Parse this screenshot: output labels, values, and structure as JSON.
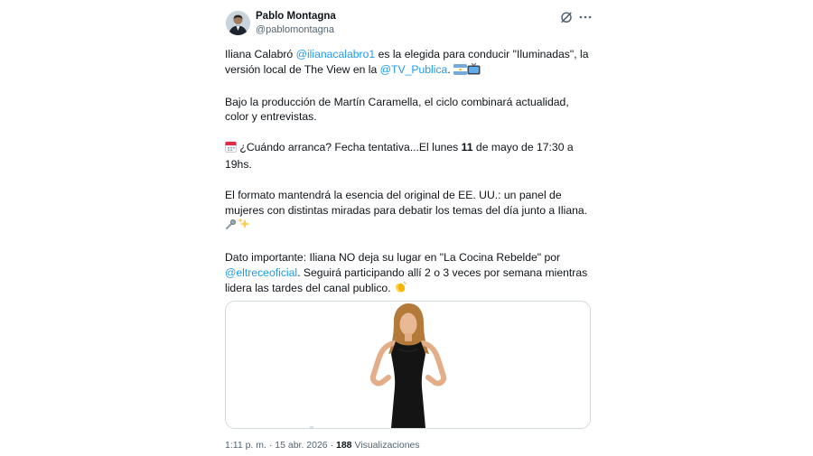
{
  "author": {
    "name": "Pablo Montagna",
    "handle": "@pablomontagna"
  },
  "tweet": {
    "p1": {
      "t1": "Iliana Calabró ",
      "m1": "@ilianacalabro1",
      "t2": " es la elegida para conducir \"Iluminadas\", la versión local de The View en la ",
      "m2": "@TV_Publica",
      "t3": ". "
    },
    "p2": "Bajo la producción de Martín Caramella, el ciclo combinará actualidad, color y entrevistas.",
    "p3": {
      "t1": " ¿Cuándo arranca? Fecha tentativa...El lunes ",
      "bold": "11",
      "t2": " de mayo de 17:30 a 19hs."
    },
    "p4": "El formato mantendrá la esencia del original de EE. UU.: un panel de mujeres con distintas miradas para debatir los temas del día junto a Iliana. ",
    "p5": {
      "t1": "Dato importante: Iliana NO deja su lugar en \"La Cocina Rebelde\" por ",
      "m1": "@eltreceoficial",
      "t2": ". Seguirá participando allí 2 o 3 veces por semana mientras lidera las tardes del canal publico. "
    }
  },
  "emoji_icons": [
    "argentina-flag-icon",
    "television-icon",
    "calendar-icon",
    "microphone-icon",
    "sparkles-icon",
    "clapping-hands-icon"
  ],
  "meta": {
    "time": "1:11 p. m.",
    "sep1": " · ",
    "date": "15 abr. 2026",
    "sep2": " · ",
    "views": "188",
    "views_label": " Visualizaciones"
  },
  "colors": {
    "link": "#1d9bf0",
    "text": "#0f1419",
    "secondary": "#536471",
    "border": "#cfd9de"
  }
}
